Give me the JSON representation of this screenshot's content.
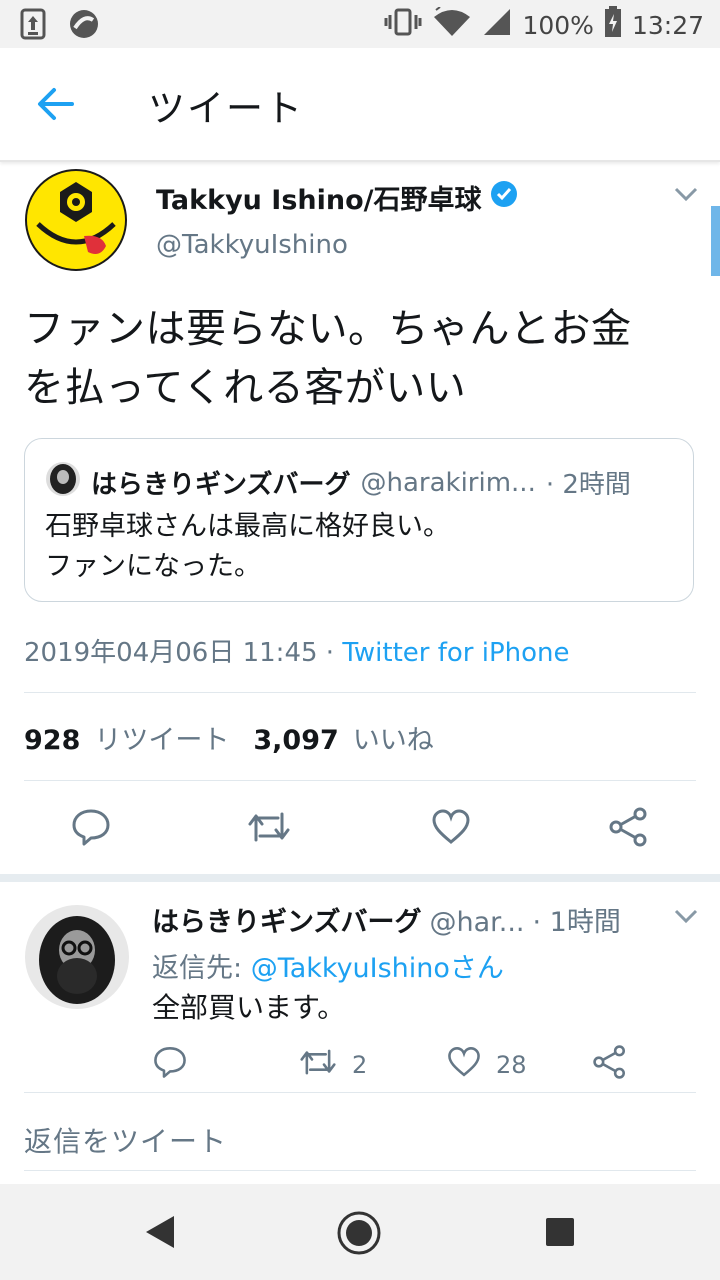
{
  "status_bar": {
    "battery": "100%",
    "time": "13:27"
  },
  "header": {
    "title": "ツイート"
  },
  "tweet": {
    "author_name": "Takkyu Ishino/石野卓球",
    "handle": "@TakkyuIshino",
    "text_line1": "ファンは要らない。ちゃんとお金",
    "text_line2": "を払ってくれる客がいい",
    "quote": {
      "name": "はらきりギンズバーグ",
      "handle": "@harakirim...",
      "time": "· 2時間",
      "line1": "石野卓球さんは最高に格好良い。",
      "line2": "ファンになった。"
    },
    "timestamp": "2019年04月06日 11:45 · ",
    "source": "Twitter for iPhone",
    "retweets": "928",
    "retweets_label": "リツイート",
    "likes": "3,097",
    "likes_label": "いいね"
  },
  "reply": {
    "name": "はらきりギンズバーグ",
    "handle": "@har...",
    "time": "· 1時間",
    "reply_to_prefix": "返信先: ",
    "reply_to_mention": "@TakkyuIshinoさん",
    "text": "全部買います。",
    "retweet_count": "2",
    "like_count": "28"
  },
  "compose_placeholder": "返信をツイート",
  "colors": {
    "accent": "#1da1f2",
    "secondary_text": "#657786",
    "divider": "#e1e8ed"
  }
}
